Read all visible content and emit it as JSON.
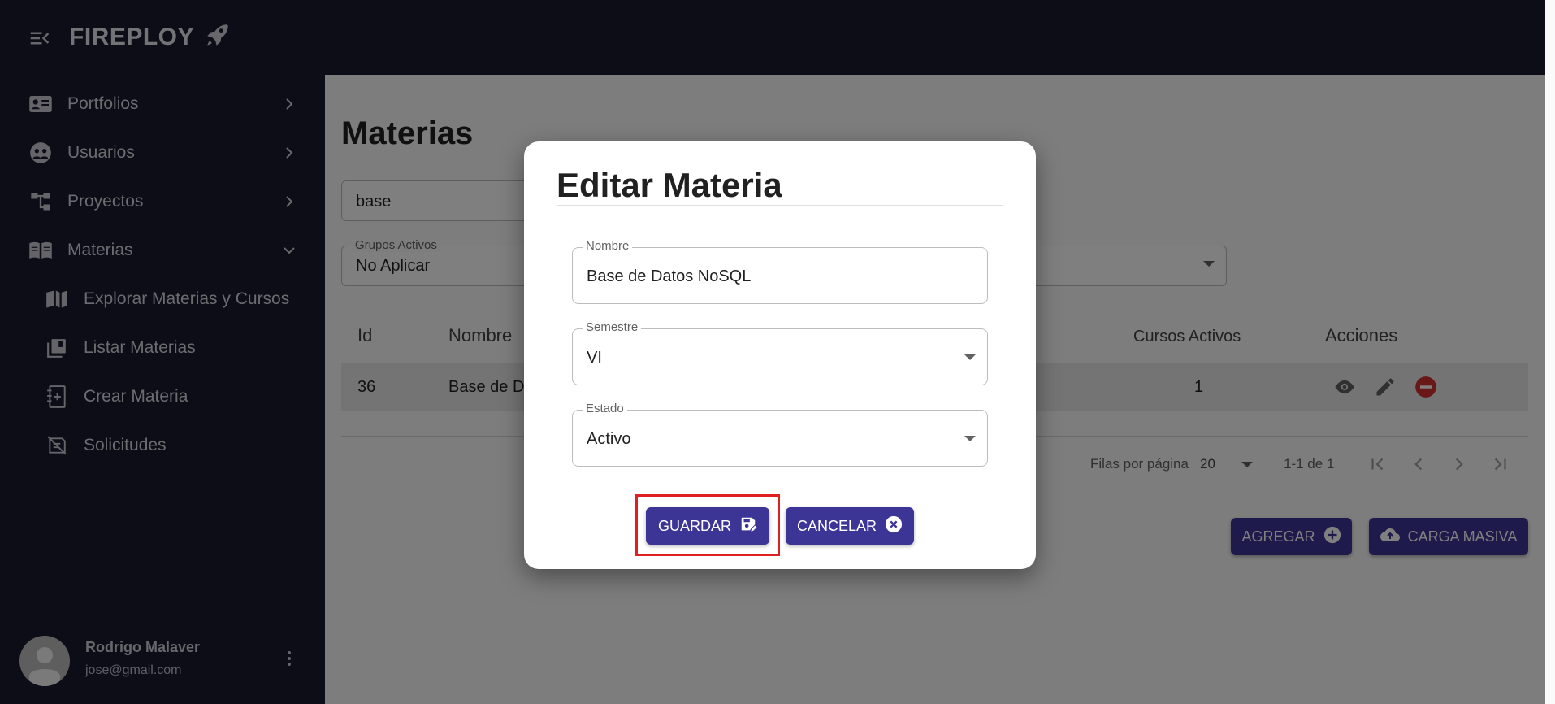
{
  "brand": {
    "name": "FIREPLOY"
  },
  "sidebar": {
    "items": [
      {
        "label": "Portfolios",
        "icon": "contact-card-icon"
      },
      {
        "label": "Usuarios",
        "icon": "users-icon"
      },
      {
        "label": "Proyectos",
        "icon": "project-tree-icon"
      },
      {
        "label": "Materias",
        "icon": "book-open-icon"
      }
    ],
    "subitems": [
      {
        "label": "Explorar Materias y Cursos",
        "icon": "book-explore-icon"
      },
      {
        "label": "Listar Materias",
        "icon": "library-books-icon"
      },
      {
        "label": "Crear Materia",
        "icon": "book-add-icon"
      },
      {
        "label": "Solicitudes",
        "icon": "request-icon"
      }
    ],
    "user": {
      "name": "Rodrigo Malaver",
      "email": "jose@gmail.com"
    }
  },
  "main": {
    "title": "Materias",
    "search_value": "base",
    "filter": {
      "label": "Grupos Activos",
      "value": "No Aplicar"
    },
    "table": {
      "headers": {
        "id": "Id",
        "nombre": "Nombre",
        "cursos": "Cursos Activos",
        "acciones": "Acciones"
      },
      "rows": [
        {
          "id": "36",
          "nombre": "Base de D",
          "cursos": "1"
        }
      ]
    },
    "pagination": {
      "rows_label": "Filas por página",
      "rows_value": "20",
      "range": "1-1 de 1"
    },
    "buttons": {
      "agregar": "AGREGAR",
      "carga": "CARGA MASIVA"
    }
  },
  "modal": {
    "title": "Editar Materia",
    "fields": {
      "nombre": {
        "label": "Nombre",
        "value": "Base de Datos NoSQL"
      },
      "semestre": {
        "label": "Semestre",
        "value": "VI"
      },
      "estado": {
        "label": "Estado",
        "value": "Activo"
      }
    },
    "buttons": {
      "guardar": "GUARDAR",
      "cancelar": "CANCELAR"
    }
  },
  "colors": {
    "topbar": "#1a1a30",
    "primary_button": "#3d3596",
    "highlight": "#e02020",
    "delete": "#d32f2f"
  }
}
